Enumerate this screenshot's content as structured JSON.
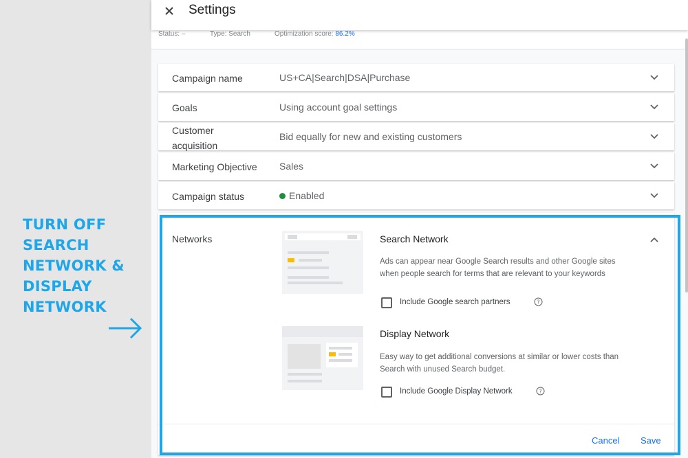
{
  "annotation": {
    "lines": [
      "TURN OFF",
      "SEARCH",
      "NETWORK &",
      "DISPLAY",
      "NETWORK"
    ],
    "color": "#1ea7e8"
  },
  "header": {
    "title": "Settings",
    "close_icon": "close-icon"
  },
  "status_bar": {
    "status": "Status: –",
    "type": "Type: Search",
    "score_label": "Optimization score:",
    "score_value": "86.2%"
  },
  "settings_rows": [
    {
      "label": "Campaign name",
      "value": "US+CA|Search|DSA|Purchase"
    },
    {
      "label": "Goals",
      "value": "Using account goal settings"
    },
    {
      "label": "Customer acquisition",
      "value": "Bid equally for new and existing customers"
    },
    {
      "label": "Marketing Objective",
      "value": "Sales"
    },
    {
      "label": "Campaign status",
      "value": "Enabled",
      "status_color": "#1e8e3e"
    }
  ],
  "networks": {
    "label": "Networks",
    "search": {
      "title": "Search Network",
      "description": "Ads can appear near Google Search results and other Google sites when people search for terms that are relevant to your keywords",
      "checkbox_label": "Include Google search partners",
      "checked": false
    },
    "display": {
      "title": "Display Network",
      "description": "Easy way to get additional conversions at similar or lower costs than Search with unused Search budget.",
      "checkbox_label": "Include Google Display Network",
      "checked": false
    },
    "cancel_label": "Cancel",
    "save_label": "Save"
  },
  "colors": {
    "accent": "#1a73e8",
    "annotation": "#1ea7e8",
    "enabled": "#1e8e3e",
    "illustration_ad": "#fbbc04"
  }
}
